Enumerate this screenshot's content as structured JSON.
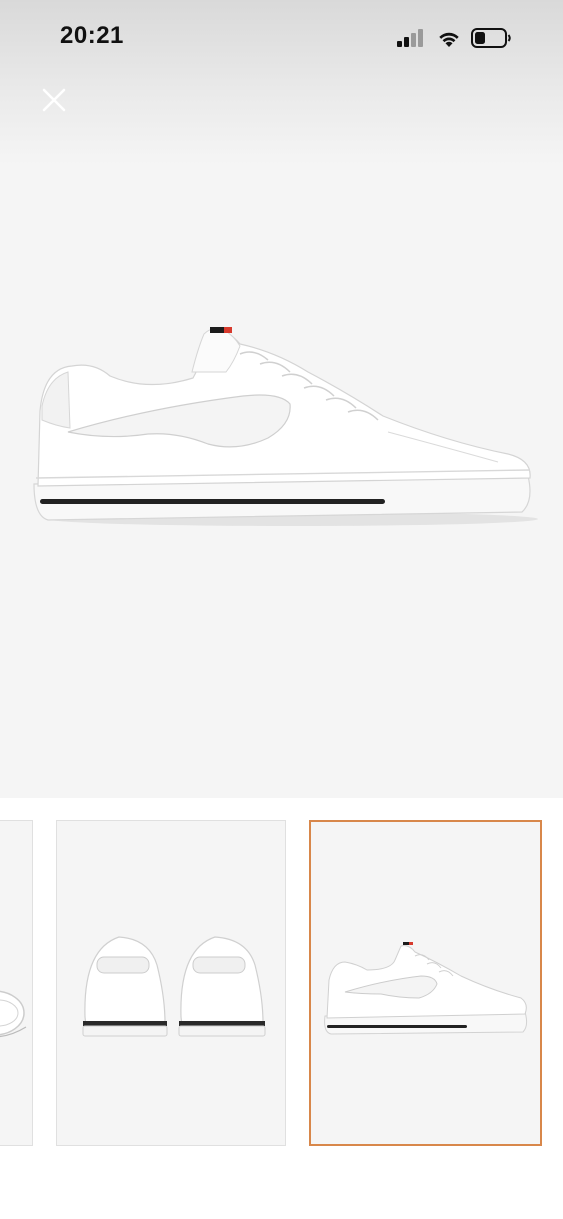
{
  "status_bar": {
    "time": "20:21",
    "icons": [
      "cellular-signal-icon",
      "wifi-icon",
      "battery-icon"
    ]
  },
  "header": {
    "close_icon": "close-icon"
  },
  "gallery": {
    "selected_index": 2,
    "accent_color": "#d8874a",
    "background_color": "#f5f5f5",
    "thumbnails": [
      {
        "view": "sole"
      },
      {
        "view": "back"
      },
      {
        "view": "side"
      }
    ]
  }
}
